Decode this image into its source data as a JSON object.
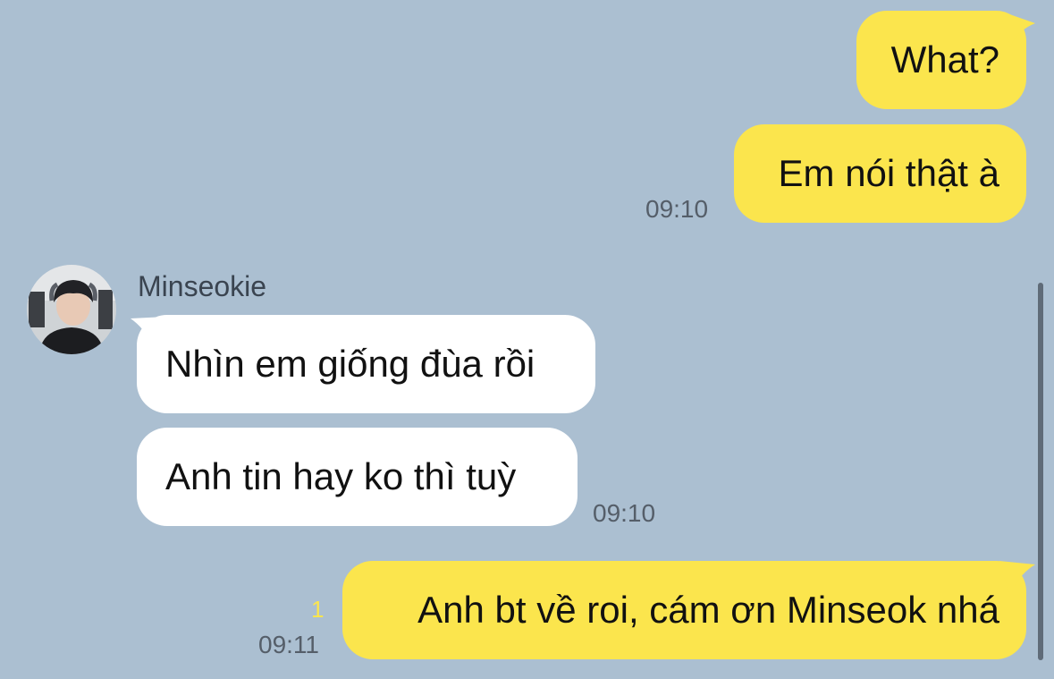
{
  "conversation": {
    "contact_name": "Minseokie",
    "messages": [
      {
        "sender": "me",
        "text": "What?"
      },
      {
        "sender": "me",
        "text": "Em nói thật à",
        "time": "09:10"
      },
      {
        "sender": "contact",
        "text": "Nhìn em giống đùa rồi"
      },
      {
        "sender": "contact",
        "text": "Anh tin hay ko thì tuỳ",
        "time": "09:10"
      },
      {
        "sender": "me",
        "text": "Anh bt về roi, cám ơn Minseok nhá",
        "time": "09:11",
        "unread_count": "1"
      }
    ]
  },
  "colors": {
    "background": "#abbfd1",
    "my_bubble": "#fbe54d",
    "contact_bubble": "#ffffff",
    "timestamp": "#555e69",
    "unread_indicator": "#fbe54d"
  },
  "icons": {
    "avatar": "profile-photo"
  }
}
